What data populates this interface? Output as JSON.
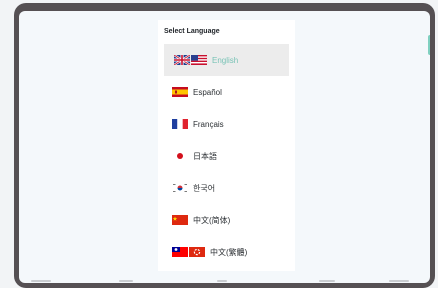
{
  "panel": {
    "title": "Select Language"
  },
  "languages": [
    {
      "label": "English",
      "flags": [
        "uk-flag-icon",
        "us-flag-icon"
      ],
      "selected": true
    },
    {
      "label": "Español",
      "flags": [
        "spain-flag-icon"
      ]
    },
    {
      "label": "Français",
      "flags": [
        "france-flag-icon"
      ]
    },
    {
      "label": "日本語",
      "flags": [
        "japan-flag-icon"
      ]
    },
    {
      "label": "한국어",
      "flags": [
        "korea-flag-icon"
      ]
    },
    {
      "label": "中文(简体)",
      "flags": [
        "china-flag-icon"
      ]
    },
    {
      "label": "中文(繁體)",
      "flags": [
        "taiwan-flag-icon",
        "hongkong-flag-icon"
      ]
    }
  ],
  "colors": {
    "selected_text": "#79c3b6",
    "device_frame": "#555053",
    "accent": "#7fd0c0"
  }
}
